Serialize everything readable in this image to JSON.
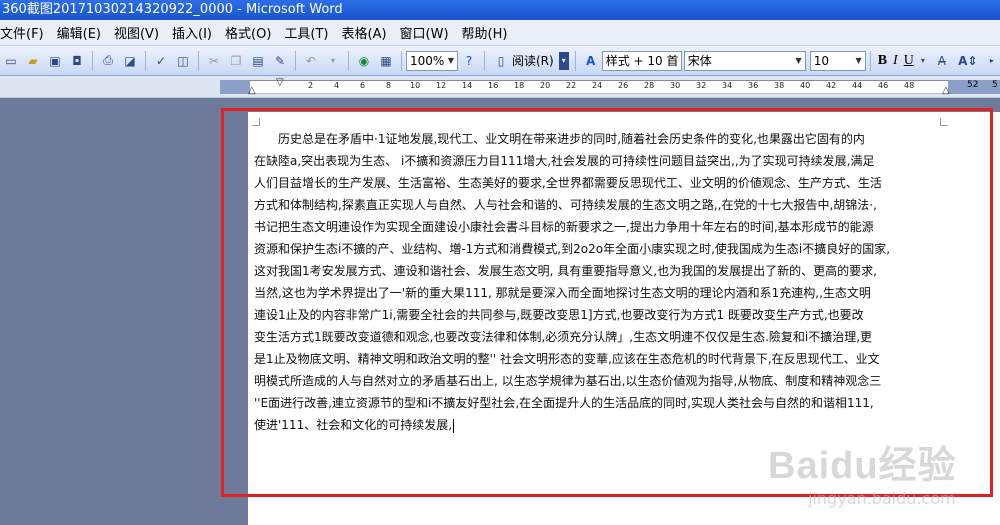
{
  "window": {
    "title": "360截图20171030214320922_0000 - Microsoft Word"
  },
  "menu": {
    "items": [
      "文件(F)",
      "编辑(E)",
      "视图(V)",
      "插入(I)",
      "格式(O)",
      "工具(T)",
      "表格(A)",
      "窗口(W)",
      "帮助(H)"
    ]
  },
  "toolbar": {
    "zoom": "100%",
    "read_label": "阅读(R)",
    "style_value": "样式 + 10 首",
    "font_value": "宋体",
    "size_value": "10",
    "bold_label": "B",
    "italic_label": "I",
    "underline_label": "U"
  },
  "ruler": {
    "numbers": [
      "2",
      "4",
      "6",
      "8",
      "10",
      "12",
      "14",
      "16",
      "18",
      "20",
      "22",
      "24",
      "26",
      "28",
      "30",
      "32",
      "34",
      "36",
      "38",
      "40",
      "42",
      "44",
      "46",
      "48"
    ],
    "end_left": "52",
    "end_right": "5"
  },
  "document": {
    "lines": [
      "　　历史总是在矛盾中·1证地发展,现代工、业文明在带来进步的同时,随着社会历史条件的变化,也果露出它固有的内",
      "在缺陸a,突出表现为生态、 i不擴和资源压力目111增大,社会发展的可持续性问题目益突出,,为了实现可持续发展,满足",
      "人们目益增长的生产发展、生活富裕、生态美好的要求,全世界都需要反思现代工、业文明的价値观念、生产方式、生活",
      "方式和体制结构,探素直正实现人与自然、人与社会和谐的、可持续发展的生态文明之路,,在党的十七大报告中,胡锦法·,",
      "书记把生态文明連设作为实现全面建设小康社会書斗目标的新要求之一,提出力争用十年左右的时间,基本形成节的能源",
      "资源和保护生态i不擴的产、业结构、増-1方式和消費模式,到2o2o年全面小康实现之时,使我国成为生态i不擴良好的国家,",
      "这对我国1考安发展方式、連设和谐社会、发展生态文明, 具有重要指导意义,也为我国的发展提出了新的、更高的要求,",
      "当然,这也为学术界提出了一'新的重大果111, 那就是要深入而全面地探讨生态文明的理论内酒和系1充連构,,生态文明",
      "連设1止及的内容非常广1i,需要全社会的共同参与,既要改变思1]方式,也要改变行为方式1  既要改变生产方式,也要改",
      "变生活方式1既要改变道德和观念,也要改变法律和体制,必须充分认牌」,生态文明連不仅仅是生态.險复和i不擴治理,更",
      "是1止及物底文明、精神文明和政治文明的整'' 社会文明形态的变華,应该在生态危机的时代背景下,在反思现代工、业文",
      "明模式所造成的人与自然对立的矛盾基石出上, 以生态学規律为基石出,以生态价値观为指导,从物底、制度和精神观念三",
      "''E面进行改善,連立资源节的型和i不擴友好型社会,在全面提升人的生活品底的同时,实现人类社会与自然的和谐相111,",
      "使进'111、社会和文化的可持续发展,"
    ]
  },
  "watermark": {
    "logo": "Baidu经验",
    "sub": "jingyan.baidu.com"
  },
  "colors": {
    "title_bar": "#1a55cc",
    "highlight": "#e32121",
    "workspace": "#6d7a99"
  }
}
